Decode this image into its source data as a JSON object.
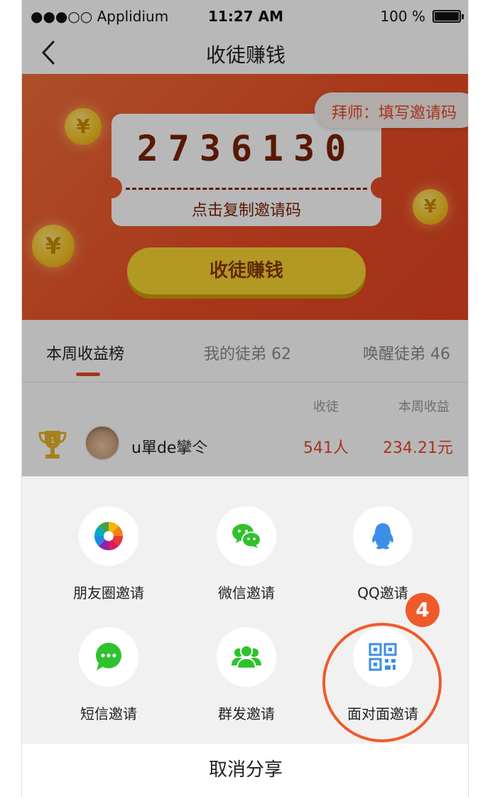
{
  "status_bar": {
    "carrier": "●●●○○ Applidium",
    "time": "11:27 AM",
    "battery": "100 %"
  },
  "nav": {
    "title": "收徒赚钱"
  },
  "banner": {
    "invite_pill": "拜师：填写邀请码",
    "invite_code": "2736130",
    "copy_label": "点击复制邀请码",
    "earn_button": "收徒赚钱",
    "coin_symbol": "¥"
  },
  "tabs": [
    "本周收益榜",
    "我的徒弟 62",
    "唤醒徒弟 46"
  ],
  "table": {
    "headers": [
      "收徒",
      "本周收益"
    ],
    "rows": [
      {
        "rank": "1",
        "username": "u單de攣仒",
        "apprentices": "541人",
        "income": "234.21元"
      }
    ]
  },
  "share": {
    "items": [
      {
        "label": "朋友圈邀请",
        "icon": "moments-icon"
      },
      {
        "label": "微信邀请",
        "icon": "wechat-icon"
      },
      {
        "label": "QQ邀请",
        "icon": "qq-icon"
      },
      {
        "label": "短信邀请",
        "icon": "sms-icon"
      },
      {
        "label": "群发邀请",
        "icon": "group-send-icon"
      },
      {
        "label": "面对面邀请",
        "icon": "qr-code-icon"
      }
    ],
    "step_badge": "4",
    "cancel": "取消分享"
  },
  "colors": {
    "accent": "#e4492a",
    "button_yellow": "#f7d533",
    "wechat_green": "#2fc22c",
    "qq_blue": "#3b8fe8"
  }
}
